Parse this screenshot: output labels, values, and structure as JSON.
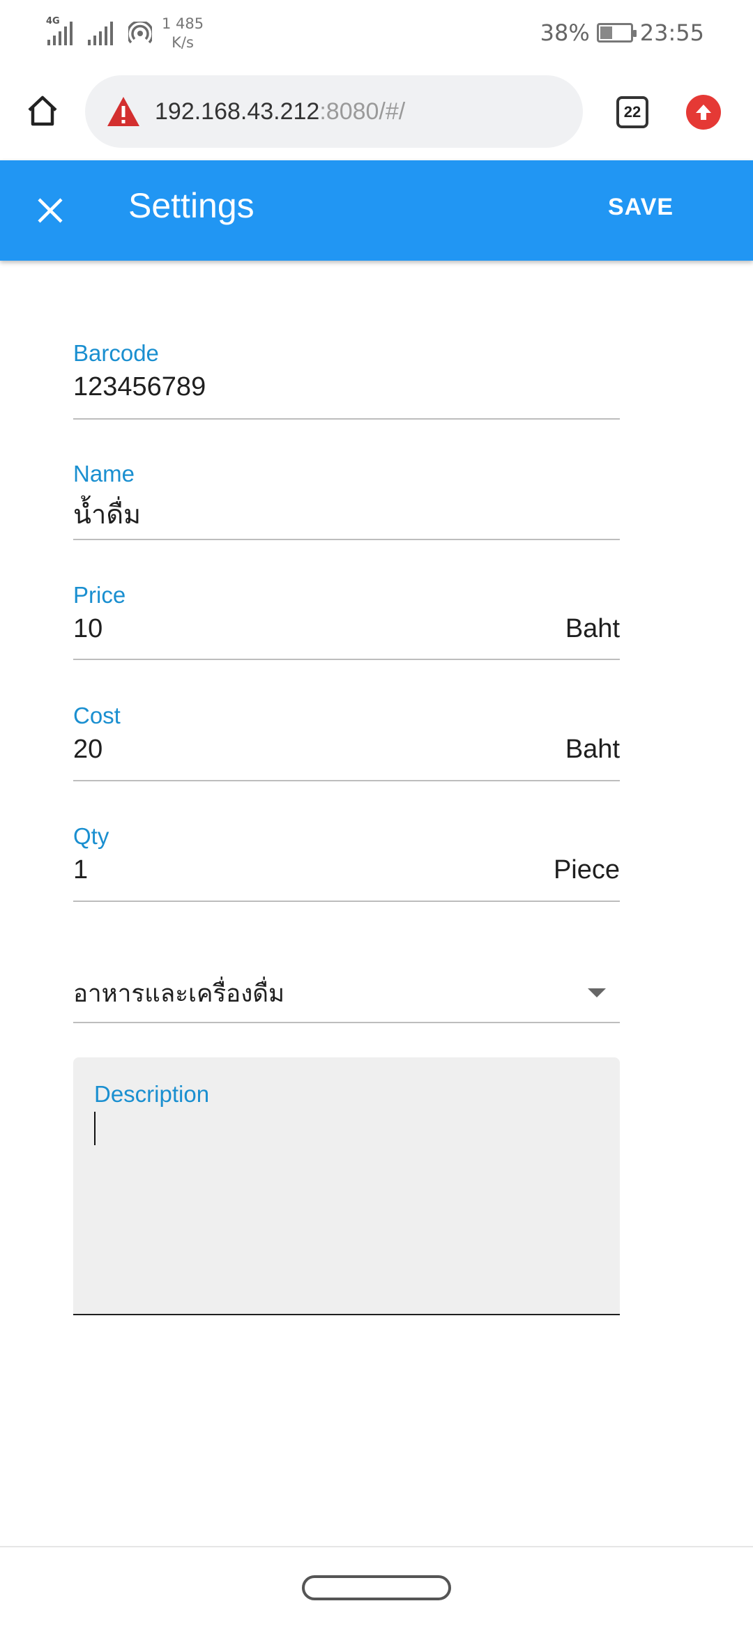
{
  "status_bar": {
    "network_type": "4G",
    "net_speed_value": "1 485",
    "net_speed_unit": "K/s",
    "battery": "38%",
    "time": "23:55"
  },
  "browser": {
    "url_host": "192.168.43.212",
    "url_rest": ":8080/#/",
    "tab_count": "22"
  },
  "toolbar": {
    "title": "Settings",
    "save_label": "SAVE"
  },
  "form": {
    "barcode": {
      "label": "Barcode",
      "value": "123456789"
    },
    "name": {
      "label": "Name",
      "value": "น้ำดื่ม"
    },
    "price": {
      "label": "Price",
      "value": "10",
      "unit": "Baht"
    },
    "cost": {
      "label": "Cost",
      "value": "20",
      "unit": "Baht"
    },
    "qty": {
      "label": "Qty",
      "value": "1",
      "unit": "Piece"
    },
    "category": {
      "value": "อาหารและเครื่องดื่ม"
    },
    "description": {
      "label": "Description",
      "value": ""
    }
  },
  "colors": {
    "accent": "#2196f3",
    "label": "#1a8fd0",
    "warning": "#d32f2f"
  }
}
